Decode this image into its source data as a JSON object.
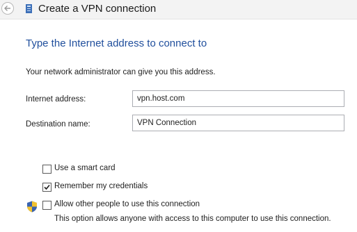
{
  "window": {
    "title": "Create a VPN connection",
    "back_icon": "back-arrow-icon",
    "app_icon": "network-icon"
  },
  "page": {
    "heading": "Type the Internet address to connect to",
    "hint": "Your network administrator can give you this address."
  },
  "fields": {
    "internet_address_label": "Internet address:",
    "internet_address_value": "vpn.host.com",
    "destination_name_label": "Destination name:",
    "destination_name_value": "VPN Connection"
  },
  "options": {
    "smart_card": {
      "label": "Use a smart card",
      "checked": false
    },
    "remember_credentials": {
      "label": "Remember my credentials",
      "checked": true
    },
    "allow_others": {
      "label": "Allow other people to use this connection",
      "checked": false,
      "description": "This option allows anyone with access to this computer to use this connection.",
      "icon": "uac-shield-icon"
    }
  },
  "colors": {
    "heading": "#1f4e9c",
    "titlebar": "#f3f3f3"
  }
}
